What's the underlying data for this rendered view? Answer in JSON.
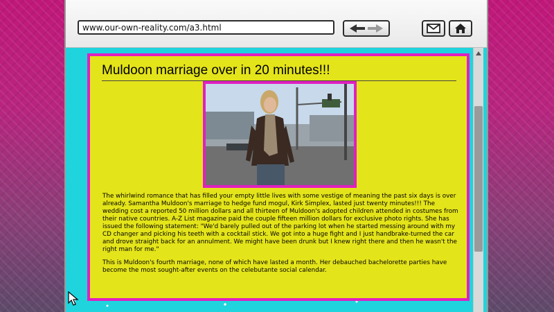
{
  "browser": {
    "url": "www.our-own-reality.com/a3.html"
  },
  "toolbar": {
    "nav_icon": "back-forward-arrows-icon",
    "mail_icon": "envelope-icon",
    "home_icon": "home-icon"
  },
  "article": {
    "headline": "Muldoon marriage over in 20 minutes!!!",
    "paragraph1": "The whirlwind romance that has filled your empty little lives with some vestige of meaning the past six days is over already.  Samantha Muldoon's marriage to hedge fund mogul, Kirk Simplex, lasted just twenty minutes!!!  The wedding cost a reported 50 million dollars and all thirteen of Muldoon's adopted children attended in costumes from their native countries.  A-Z List magazine paid the couple fifteen million dollars for exclusive photo rights.  She has issued the following statement:  \"We'd barely pulled out of the parking lot when he started messing around with my CD changer and picking his teeth with a cocktail stick.  We got into a huge fight and I just handbrake-turned the car and drove straight back for an annulment.  We might have been drunk but I knew right there and then he wasn't the right man for me.\"",
    "paragraph2": "This is Muldoon's fourth marriage, none of which have lasted a month.  Her debauched bachelorette parties have become the most sought-after events on the celebutante social calendar."
  },
  "colors": {
    "page_background": "#1fd4dd",
    "article_background": "#e4e41a",
    "border_magenta": "#e020c0"
  }
}
